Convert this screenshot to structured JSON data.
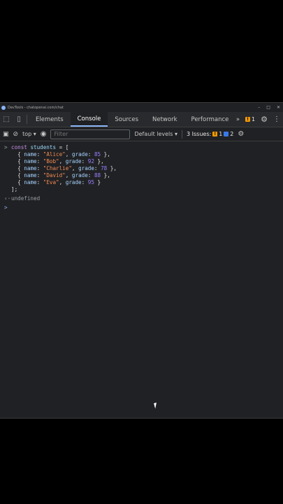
{
  "window": {
    "title": "DevTools - chatopenai.com/chat"
  },
  "tabs": [
    "Elements",
    "Console",
    "Sources",
    "Network",
    "Performance"
  ],
  "active_tab": "Console",
  "tabs_more": "»",
  "warnings_count": "1",
  "toolbar": {
    "context": "top",
    "filter_placeholder": "Filter",
    "levels": "Default levels",
    "issues_label": "3 Issues:",
    "issues_warn": "1",
    "issues_info": "2"
  },
  "console": {
    "line1": "const students = [",
    "rows": [
      {
        "name": "\"Alice\"",
        "grade": "85",
        "end": " },"
      },
      {
        "name": "\"Bob\"",
        "grade": "92",
        "end": " },"
      },
      {
        "name": "\"Charlie\"",
        "grade": "78",
        "end": " },"
      },
      {
        "name": "\"David\"",
        "grade": "88",
        "end": " },"
      },
      {
        "name": "\"Eva\"",
        "grade": "95",
        "end": " }"
      }
    ],
    "close": "];",
    "result": "undefined"
  },
  "colors": {
    "accent": "#8ab4f8",
    "warn": "#f29900",
    "info": "#3b78e7"
  }
}
